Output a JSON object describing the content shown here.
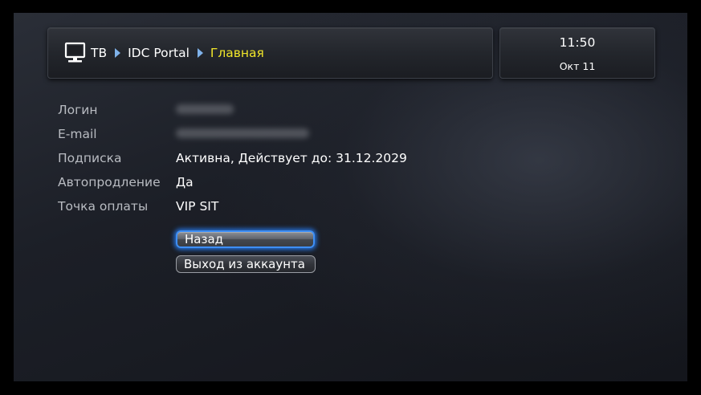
{
  "header": {
    "breadcrumb": [
      {
        "label": "ТВ"
      },
      {
        "label": "IDC Portal"
      },
      {
        "label": "Главная"
      }
    ],
    "icons": {
      "tv": "tv-icon",
      "separator": "chevron-right-icon"
    },
    "colors": {
      "current_crumb": "#f0e52a",
      "separator": "#7fb2ea"
    }
  },
  "clock": {
    "time": "11:50",
    "date": "Окт 11"
  },
  "account": {
    "rows": [
      {
        "label": "Логин",
        "value": "",
        "redacted": true
      },
      {
        "label": "E-mail",
        "value": "",
        "redacted": true
      },
      {
        "label": "Подписка",
        "value": "Активна, Действует до: 31.12.2029"
      },
      {
        "label": "Автопродление",
        "value": "Да"
      },
      {
        "label": "Точка оплаты",
        "value": "VIP SIT"
      }
    ]
  },
  "actions": {
    "back_label": "Назад",
    "logout_label": "Выход из аккаунта",
    "focus_color": "#3f8ff5"
  }
}
